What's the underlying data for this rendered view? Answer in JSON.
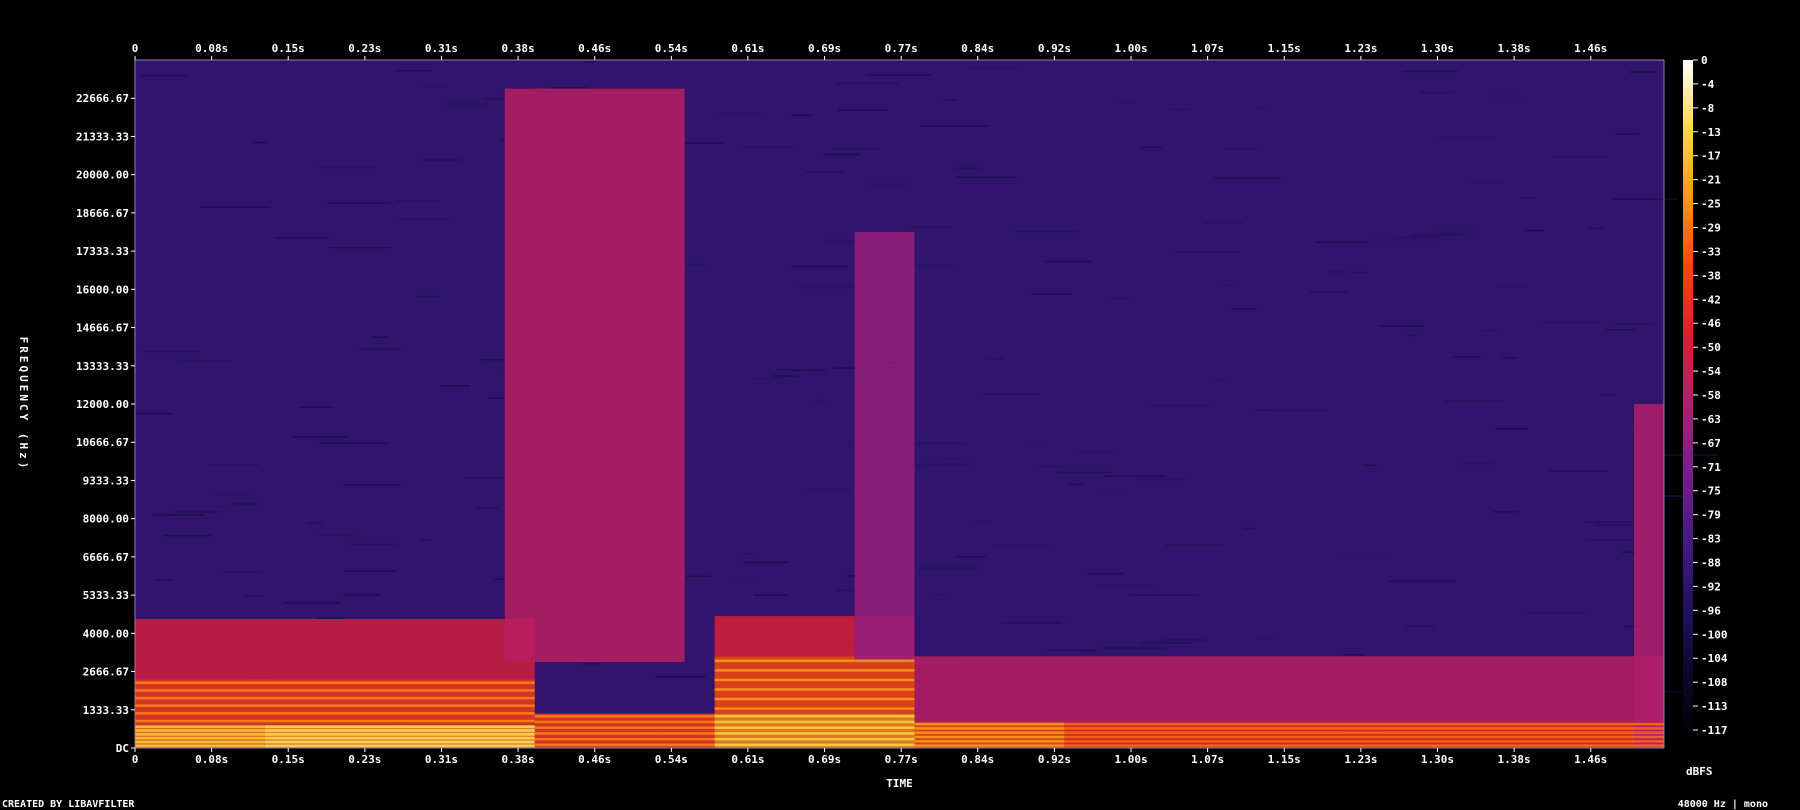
{
  "chart_data": {
    "type": "heatmap",
    "title": "",
    "xlabel": "TIME",
    "ylabel": "FREQUENCY (Hz)",
    "x_ticks": [
      "0",
      "0.08s",
      "0.15s",
      "0.23s",
      "0.31s",
      "0.38s",
      "0.46s",
      "0.54s",
      "0.61s",
      "0.69s",
      "0.77s",
      "0.84s",
      "0.92s",
      "1.00s",
      "1.07s",
      "1.15s",
      "1.23s",
      "1.30s",
      "1.38s",
      "1.46s"
    ],
    "x_tick_values": [
      0,
      0.0767,
      0.1533,
      0.23,
      0.3067,
      0.3833,
      0.46,
      0.5367,
      0.6133,
      0.69,
      0.7667,
      0.8433,
      0.92,
      0.9967,
      1.0733,
      1.15,
      1.2267,
      1.3033,
      1.38,
      1.4567
    ],
    "xlim": [
      0,
      1.53
    ],
    "y_ticks": [
      "DC",
      "1333.33",
      "2666.67",
      "4000.00",
      "5333.33",
      "6666.67",
      "8000.00",
      "9333.33",
      "10666.67",
      "12000.00",
      "13333.33",
      "14666.67",
      "16000.00",
      "17333.33",
      "18666.67",
      "20000.00",
      "21333.33",
      "22666.67"
    ],
    "y_tick_values": [
      0,
      1333.33,
      2666.67,
      4000,
      5333.33,
      6666.67,
      8000,
      9333.33,
      10666.67,
      12000,
      13333.33,
      14666.67,
      16000,
      17333.33,
      18666.67,
      20000,
      21333.33,
      22666.67
    ],
    "ylim": [
      0,
      24000
    ],
    "colorbar": {
      "label": "dBFS",
      "ticks": [
        "0",
        "-4",
        "-8",
        "-13",
        "-17",
        "-21",
        "-25",
        "-29",
        "-33",
        "-38",
        "-42",
        "-46",
        "-50",
        "-54",
        "-58",
        "-63",
        "-67",
        "-71",
        "-75",
        "-79",
        "-83",
        "-88",
        "-92",
        "-96",
        "-100",
        "-104",
        "-108",
        "-113",
        "-117"
      ],
      "range": [
        -120,
        0
      ]
    },
    "colors": {
      "background": "#000000",
      "plot_base": "#3a1470",
      "border": "#9a7ab8",
      "scale": [
        "#000000",
        "#0c0830",
        "#241260",
        "#4a1a86",
        "#7a1f8c",
        "#b01f6a",
        "#e01e2e",
        "#f8480c",
        "#fd9a12",
        "#ffd848",
        "#ffffff"
      ]
    },
    "bands": [
      {
        "t0": 0.0,
        "t1": 0.13,
        "f0": 0,
        "f1": 800,
        "level": -28
      },
      {
        "t0": 0.13,
        "t1": 0.4,
        "f0": 0,
        "f1": 800,
        "level": -24
      },
      {
        "t0": 0.0,
        "t1": 0.4,
        "f0": 800,
        "f1": 2400,
        "level": -40
      },
      {
        "t0": 0.0,
        "t1": 0.4,
        "f0": 2400,
        "f1": 4500,
        "level": -52
      },
      {
        "t0": 0.4,
        "t1": 0.58,
        "f0": 0,
        "f1": 1200,
        "level": -40
      },
      {
        "t0": 0.58,
        "t1": 0.78,
        "f0": 0,
        "f1": 1200,
        "level": -26
      },
      {
        "t0": 0.58,
        "t1": 0.78,
        "f0": 1200,
        "f1": 3200,
        "level": -36
      },
      {
        "t0": 0.58,
        "t1": 0.78,
        "f0": 3200,
        "f1": 4600,
        "level": -50
      },
      {
        "t0": 0.78,
        "t1": 0.93,
        "f0": 0,
        "f1": 900,
        "level": -36
      },
      {
        "t0": 0.93,
        "t1": 1.53,
        "f0": 0,
        "f1": 900,
        "level": -44
      },
      {
        "t0": 0.78,
        "t1": 1.53,
        "f0": 900,
        "f1": 3200,
        "level": -58
      },
      {
        "t0": 0.37,
        "t1": 0.55,
        "f0": 3000,
        "f1": 23000,
        "level": -58
      },
      {
        "t0": 0.72,
        "t1": 0.78,
        "f0": 3000,
        "f1": 18000,
        "level": -66
      },
      {
        "t0": 1.5,
        "t1": 1.53,
        "f0": 0,
        "f1": 12000,
        "level": -60
      }
    ],
    "noise_floor": -92,
    "footer_left": "CREATED BY LIBAVFILTER",
    "footer_right": "48000 Hz | mono"
  }
}
